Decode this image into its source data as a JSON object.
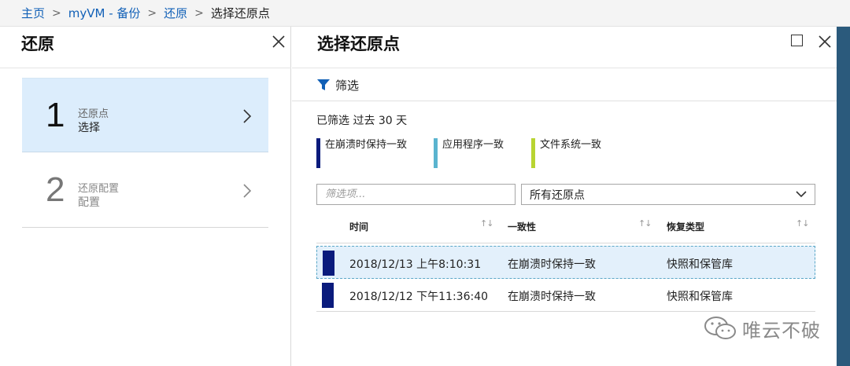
{
  "breadcrumb": {
    "items": [
      "主页",
      "myVM - 备份",
      "还原"
    ],
    "current": "选择还原点"
  },
  "left_blade": {
    "title": "还原",
    "steps": [
      {
        "number": "1",
        "label": "还原点",
        "value": "选择",
        "state": "active"
      },
      {
        "number": "2",
        "label": "还原配置",
        "value": "配置",
        "state": "inactive"
      }
    ]
  },
  "right_blade": {
    "title": "选择还原点",
    "filter_label": "筛选",
    "filtered_text": "已筛选 过去 30 天",
    "legend": [
      {
        "label": "在崩溃时保持一致",
        "color": "#0a1b7c"
      },
      {
        "label": "应用程序一致",
        "color": "#5ab4cf"
      },
      {
        "label": "文件系统一致",
        "color": "#b8d432"
      }
    ],
    "search_placeholder": "筛选项...",
    "dropdown_value": "所有还原点",
    "table": {
      "columns": [
        "时间",
        "一致性",
        "恢复类型"
      ],
      "rows": [
        {
          "time": "2018/12/13 上午8:10:31",
          "consistency": "在崩溃时保持一致",
          "recovery_type": "快照和保管库",
          "selected": true
        },
        {
          "time": "2018/12/12 下午11:36:40",
          "consistency": "在崩溃时保持一致",
          "recovery_type": "快照和保管库",
          "selected": false
        }
      ]
    }
  },
  "watermark": {
    "text": "唯云不破",
    "icon": "wechat-icon"
  },
  "colors": {
    "accent": "#1160b7",
    "active_step_bg": "#dcedfc",
    "crash_consistent": "#0a1b7c",
    "edge_strip": "#2b5a7c"
  }
}
